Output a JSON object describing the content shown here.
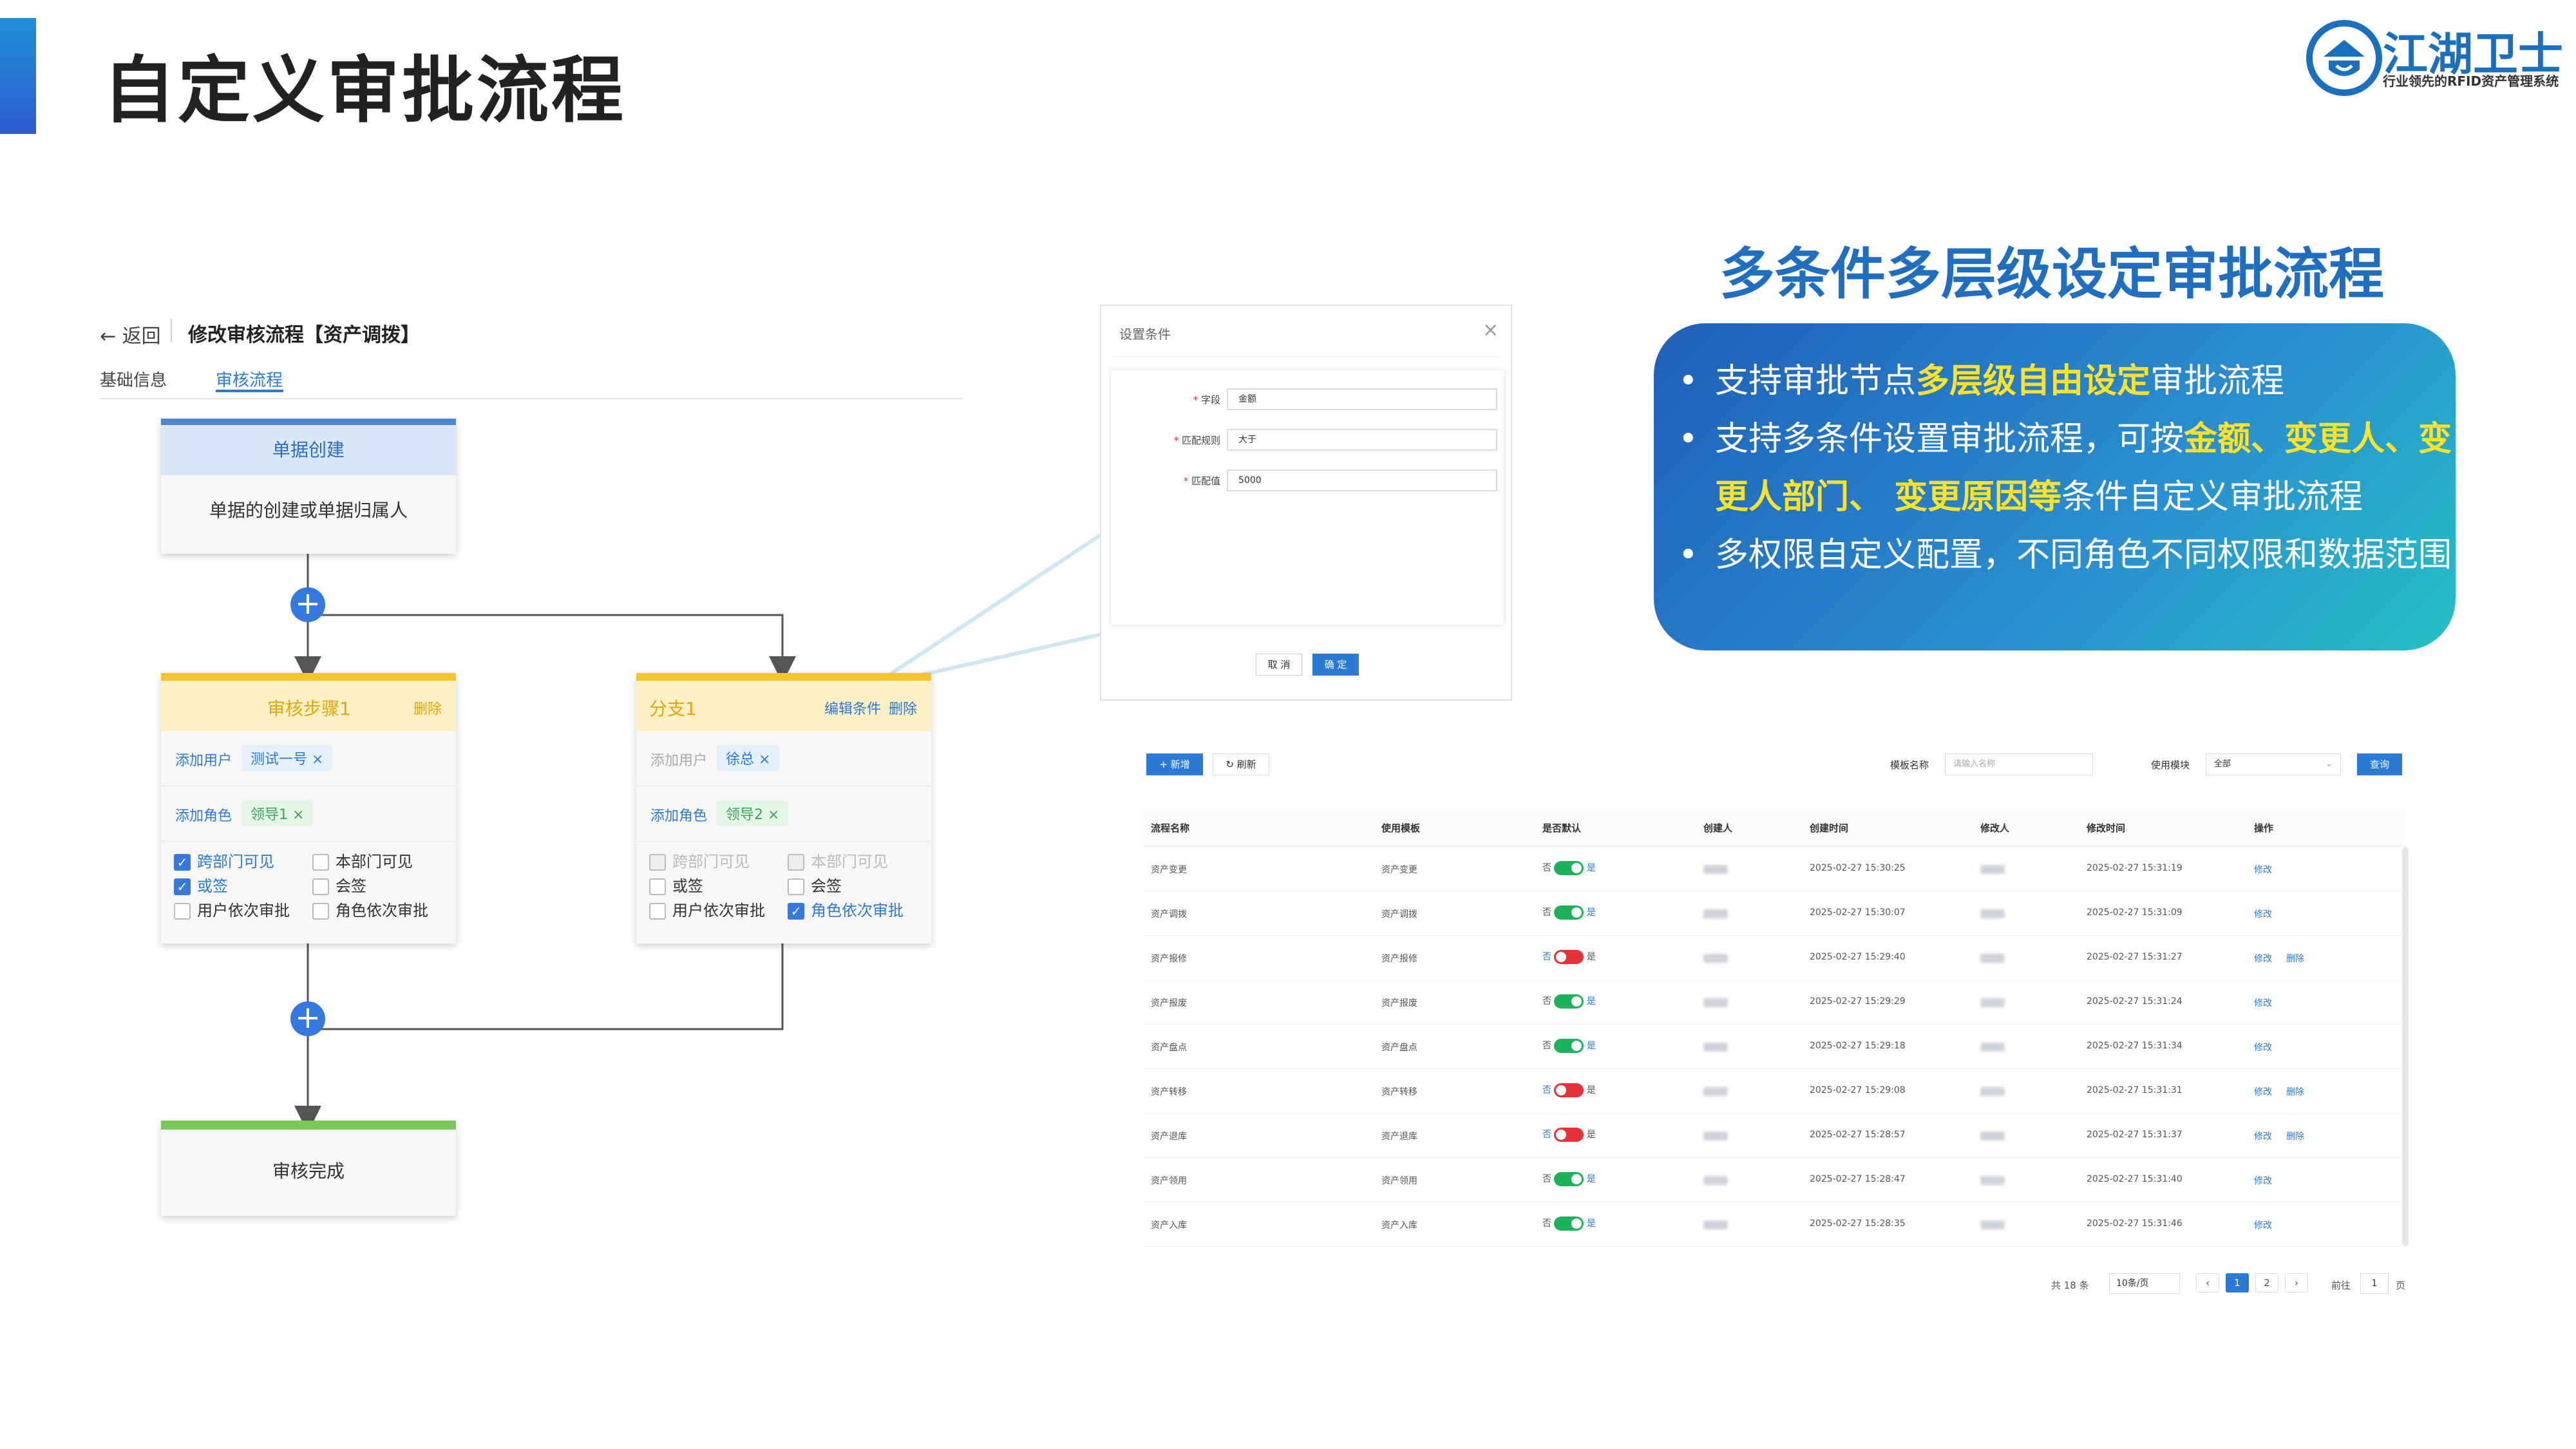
{
  "header": {
    "title": "自定义审批流程",
    "logo_name": "江湖卫士",
    "logo_tagline": "行业领先的RFID资产管理系统"
  },
  "panel": {
    "back_label": "返回",
    "page_title": "修改审核流程【资产调拨】",
    "tabs": [
      {
        "label": "基础信息"
      },
      {
        "label": "审核流程"
      }
    ],
    "start_node": {
      "title": "单据创建",
      "desc": "单据的创建或单据归属人"
    },
    "step_node": {
      "title": "审核步骤1",
      "delete": "删除",
      "add_user": "添加用户",
      "user_tag": "测试一号",
      "add_role": "添加角色",
      "role_tag": "领导1",
      "options": [
        {
          "label": "跨部门可见",
          "checked": true
        },
        {
          "label": "本部门可见",
          "checked": false
        },
        {
          "label": "或签",
          "checked": true
        },
        {
          "label": "会签",
          "checked": false
        },
        {
          "label": "用户依次审批",
          "checked": false
        },
        {
          "label": "角色依次审批",
          "checked": false
        }
      ]
    },
    "branch_node": {
      "title": "分支1",
      "edit": "编辑条件",
      "delete": "删除",
      "add_user": "添加用户",
      "user_tag": "徐总",
      "add_role": "添加角色",
      "role_tag": "领导2",
      "options": [
        {
          "label": "跨部门可见",
          "checked": true
        },
        {
          "label": "本部门可见",
          "checked": false
        },
        {
          "label": "或签",
          "checked": false
        },
        {
          "label": "会签",
          "checked": false
        },
        {
          "label": "用户依次审批",
          "checked": false
        },
        {
          "label": "角色依次审批",
          "checked": true
        }
      ]
    },
    "end_node": {
      "title": "审核完成"
    }
  },
  "dialog": {
    "title": "设置条件",
    "fields": [
      {
        "label": "字段",
        "value": "金额"
      },
      {
        "label": "匹配规则",
        "value": "大于"
      },
      {
        "label": "匹配值",
        "value": "5000"
      }
    ],
    "cancel": "取 消",
    "confirm": "确 定"
  },
  "table": {
    "add_btn": "+ 新增",
    "refresh_btn": "刷新",
    "template_label": "模板名称",
    "template_placeholder": "请输入名称",
    "module_label": "使用模块",
    "module_value": "全部",
    "search_btn": "查询",
    "columns": [
      "流程名称",
      "使用模板",
      "是否默认",
      "创建人",
      "创建时间",
      "修改人",
      "修改时间",
      "操作"
    ],
    "rows": [
      {
        "name": "资产变更",
        "template": "资产变更",
        "default": true,
        "created": "2025-02-27 15:30:25",
        "modified": "2025-02-27 15:31:19",
        "ops": [
          "修改"
        ]
      },
      {
        "name": "资产调拨",
        "template": "资产调拨",
        "default": true,
        "created": "2025-02-27 15:30:07",
        "modified": "2025-02-27 15:31:09",
        "ops": [
          "修改"
        ]
      },
      {
        "name": "资产报修",
        "template": "资产报修",
        "default": false,
        "created": "2025-02-27 15:29:40",
        "modified": "2025-02-27 15:31:27",
        "ops": [
          "修改",
          "删除"
        ]
      },
      {
        "name": "资产报废",
        "template": "资产报废",
        "default": true,
        "created": "2025-02-27 15:29:29",
        "modified": "2025-02-27 15:31:24",
        "ops": [
          "修改"
        ]
      },
      {
        "name": "资产盘点",
        "template": "资产盘点",
        "default": true,
        "created": "2025-02-27 15:29:18",
        "modified": "2025-02-27 15:31:34",
        "ops": [
          "修改"
        ]
      },
      {
        "name": "资产转移",
        "template": "资产转移",
        "default": false,
        "created": "2025-02-27 15:29:08",
        "modified": "2025-02-27 15:31:31",
        "ops": [
          "修改",
          "删除"
        ]
      },
      {
        "name": "资产退库",
        "template": "资产退库",
        "default": false,
        "created": "2025-02-27 15:28:57",
        "modified": "2025-02-27 15:31:37",
        "ops": [
          "修改",
          "删除"
        ]
      },
      {
        "name": "资产领用",
        "template": "资产领用",
        "default": true,
        "created": "2025-02-27 15:28:47",
        "modified": "2025-02-27 15:31:40",
        "ops": [
          "修改"
        ]
      },
      {
        "name": "资产入库",
        "template": "资产入库",
        "default": true,
        "created": "2025-02-27 15:28:35",
        "modified": "2025-02-27 15:31:46",
        "ops": [
          "修改"
        ]
      }
    ],
    "no_label": "否",
    "yes_label": "是",
    "footer": {
      "total": "共 18 条",
      "page_size": "10条/页",
      "pages": [
        "1",
        "2"
      ],
      "goto": "前往",
      "goto_value": "1",
      "page_unit": "页"
    }
  },
  "info": {
    "title": "多条件多层级设定审批流程",
    "lines": [
      {
        "parts": [
          {
            "t": "支持审批节点"
          },
          {
            "t": "多层级自由设定",
            "hl": true
          },
          {
            "t": "审批流程"
          }
        ]
      },
      {
        "parts": [
          {
            "t": "支持多条件设置审批流程，可按"
          },
          {
            "t": "金额、变更人、变",
            "hl": true
          }
        ]
      },
      {
        "parts": [
          {
            "t": "更人部门、 变更原因等",
            "hl": true
          },
          {
            "t": "条件自定义审批流程"
          }
        ]
      },
      {
        "parts": [
          {
            "t": "多权限自定义配置，不同角色不同权限和数据范围"
          }
        ]
      }
    ]
  },
  "colors": {
    "accent": "#2b7bd6",
    "step_yellow": "#f5c431",
    "end_green": "#7cc65c",
    "info_gradient_start": "#1f5fb8",
    "highlight": "#ffe32b"
  }
}
